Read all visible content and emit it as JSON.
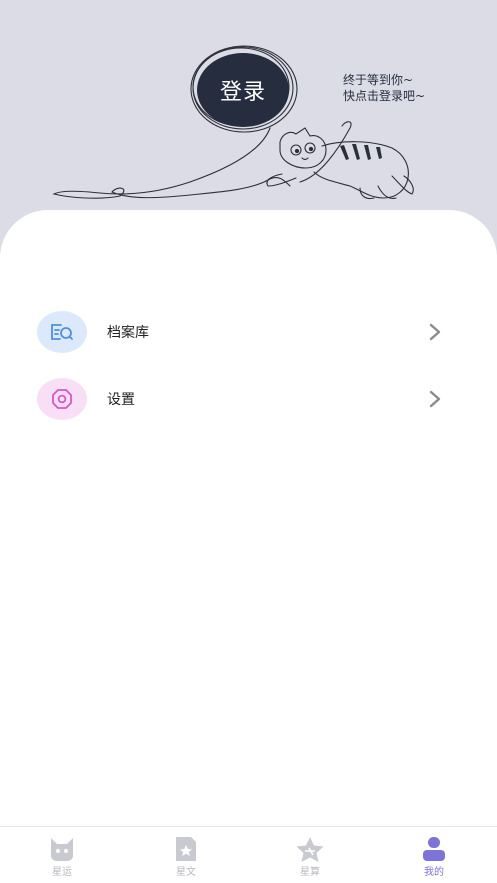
{
  "header": {
    "login_label": "登录",
    "hint_line1": "终于等到你~",
    "hint_line2": "快点击登录吧~"
  },
  "menu": [
    {
      "label": "档案库",
      "icon": "archive-search-icon",
      "icon_bg": "#dbe9fb",
      "icon_color": "#4f8fe0"
    },
    {
      "label": "设置",
      "icon": "gear-icon",
      "icon_bg": "#f9dff6",
      "icon_color": "#d457c9"
    }
  ],
  "tabbar": {
    "items": [
      {
        "label": "星运",
        "icon": "cat-face-icon",
        "active": false
      },
      {
        "label": "星文",
        "icon": "document-star-icon",
        "active": false
      },
      {
        "label": "星算",
        "icon": "star-icon",
        "active": false
      },
      {
        "label": "我的",
        "icon": "user-icon",
        "active": true
      }
    ]
  },
  "colors": {
    "header_bg": "#dcdce6",
    "login_bg": "#262d3e",
    "active_tab": "#7e74d8",
    "inactive_tab": "#b8b8c2"
  }
}
